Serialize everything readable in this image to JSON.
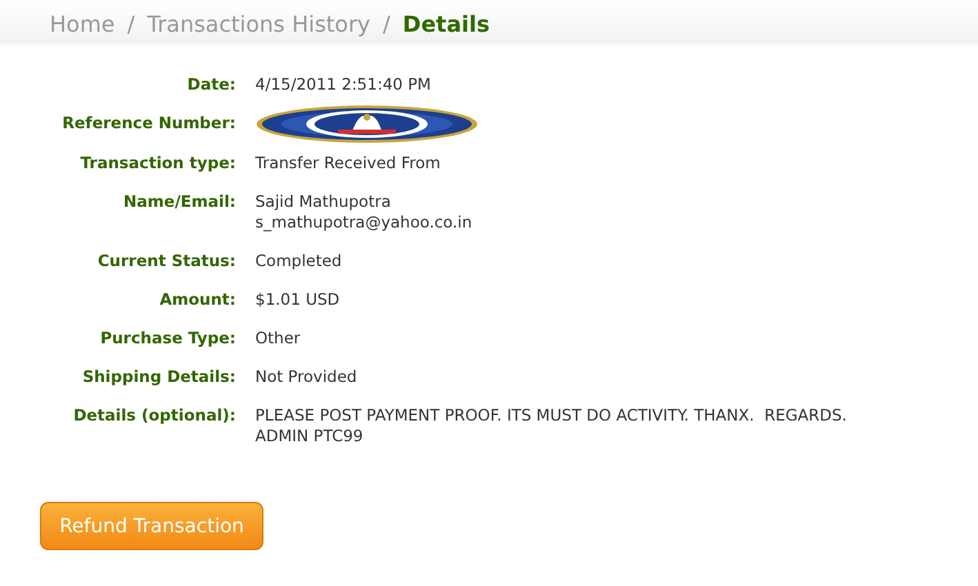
{
  "breadcrumb": [
    {
      "kind": "link",
      "label": "Home"
    },
    {
      "kind": "separator",
      "label": "/"
    },
    {
      "kind": "link",
      "label": "Transactions History"
    },
    {
      "kind": "separator",
      "label": "/"
    },
    {
      "kind": "current",
      "label": "Details"
    }
  ],
  "details": [
    {
      "kind": "text",
      "label": "Date:",
      "lines": [
        "4/15/2011 2:51:40 PM"
      ]
    },
    {
      "kind": "picture",
      "label": "Reference Number:"
    },
    {
      "kind": "text",
      "label": "Transaction type:",
      "lines": [
        "Transfer Received From"
      ]
    },
    {
      "kind": "text",
      "label": "Name/Email:",
      "lines": [
        "Sajid Mathupotra",
        "s_mathupotra@yahoo.co.in"
      ]
    },
    {
      "kind": "text",
      "label": "Current Status:",
      "lines": [
        "Completed"
      ]
    },
    {
      "kind": "text",
      "label": "Amount:",
      "lines": [
        "$1.01 USD"
      ]
    },
    {
      "kind": "text",
      "label": "Purchase Type:",
      "lines": [
        "Other"
      ]
    },
    {
      "kind": "text",
      "label": "Shipping Details:",
      "lines": [
        "Not Provided"
      ]
    },
    {
      "kind": "text",
      "label": "Details (optional):",
      "lines": [
        "PLEASE POST PAYMENT PROOF. ITS MUST DO ACTIVITY. THANX.  REGARDS.",
        "ADMIN PTC99"
      ]
    }
  ],
  "refund_button": "Refund Transaction"
}
